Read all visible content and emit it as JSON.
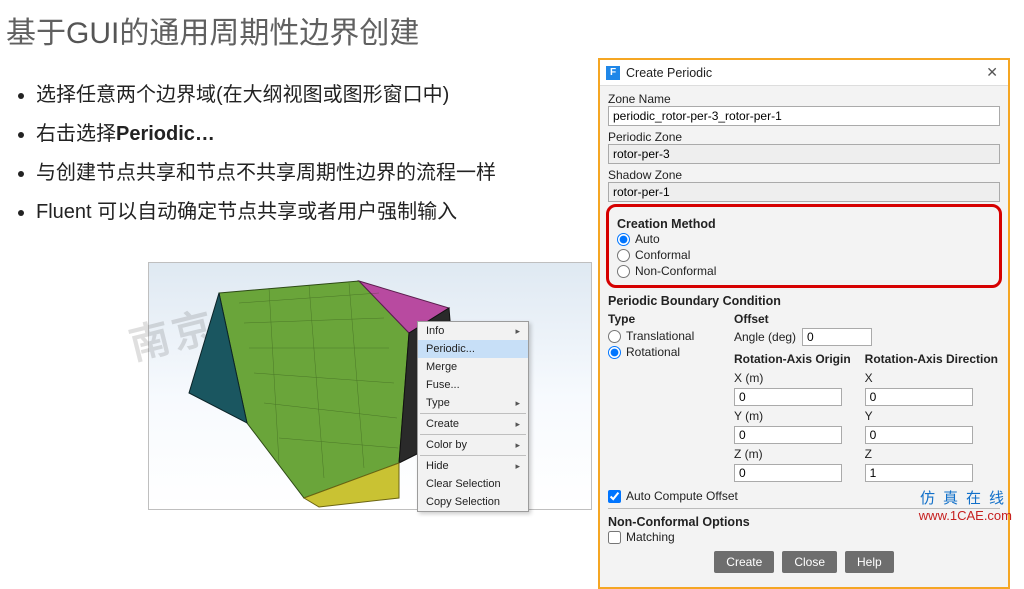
{
  "slide": {
    "title_part1": "基于",
    "title_eng": "GUI",
    "title_part2": "的通用周期性边界创建",
    "bullets": [
      "选择任意两个边界域(在大纲视图或图形窗口中)",
      "右击选择",
      "与创建节点共享和节点不共享周期性边界的流程一样",
      "Fluent 可以自动确定节点共享或者用户强制输入"
    ],
    "bullet2_keyword": "Periodic…"
  },
  "watermark": "南京安世",
  "context_menu": {
    "items": [
      {
        "label": "Info",
        "arrow": true
      },
      {
        "label": "Periodic...",
        "highlight": true
      },
      {
        "label": "Merge"
      },
      {
        "label": "Fuse..."
      },
      {
        "label": "Type",
        "arrow": true
      },
      {
        "sep": true
      },
      {
        "label": "Create",
        "arrow": true
      },
      {
        "sep": true
      },
      {
        "label": "Color by",
        "arrow": true
      },
      {
        "sep": true
      },
      {
        "label": "Hide",
        "arrow": true
      },
      {
        "label": "Clear Selection"
      },
      {
        "label": "Copy Selection"
      }
    ]
  },
  "dialog": {
    "title": "Create Periodic",
    "zone_name_label": "Zone Name",
    "zone_name_value": "periodic_rotor-per-3_rotor-per-1",
    "periodic_zone_label": "Periodic Zone",
    "periodic_zone_value": "rotor-per-3",
    "shadow_zone_label": "Shadow Zone",
    "shadow_zone_value": "rotor-per-1",
    "creation_method_label": "Creation Method",
    "creation_methods": [
      "Auto",
      "Conformal",
      "Non-Conformal"
    ],
    "pbc_label": "Periodic Boundary Condition",
    "type_label": "Type",
    "type_options": [
      "Translational",
      "Rotational"
    ],
    "offset_label": "Offset",
    "angle_label": "Angle  (deg)",
    "angle_value": "0",
    "origin_label": "Rotation-Axis Origin",
    "direction_label": "Rotation-Axis Direction",
    "axes": [
      "X",
      "Y",
      "Z"
    ],
    "axes_suffix": " (m)",
    "origin_values": [
      "0",
      "0",
      "0"
    ],
    "direction_values": [
      "0",
      "0",
      "1"
    ],
    "auto_offset_label": "Auto Compute Offset",
    "nco_label": "Non-Conformal Options",
    "nco_matching": "Matching",
    "buttons": [
      "Create",
      "Close",
      "Help"
    ]
  },
  "footer": {
    "cn": "仿真在线",
    "url": "www.1CAE.com"
  }
}
